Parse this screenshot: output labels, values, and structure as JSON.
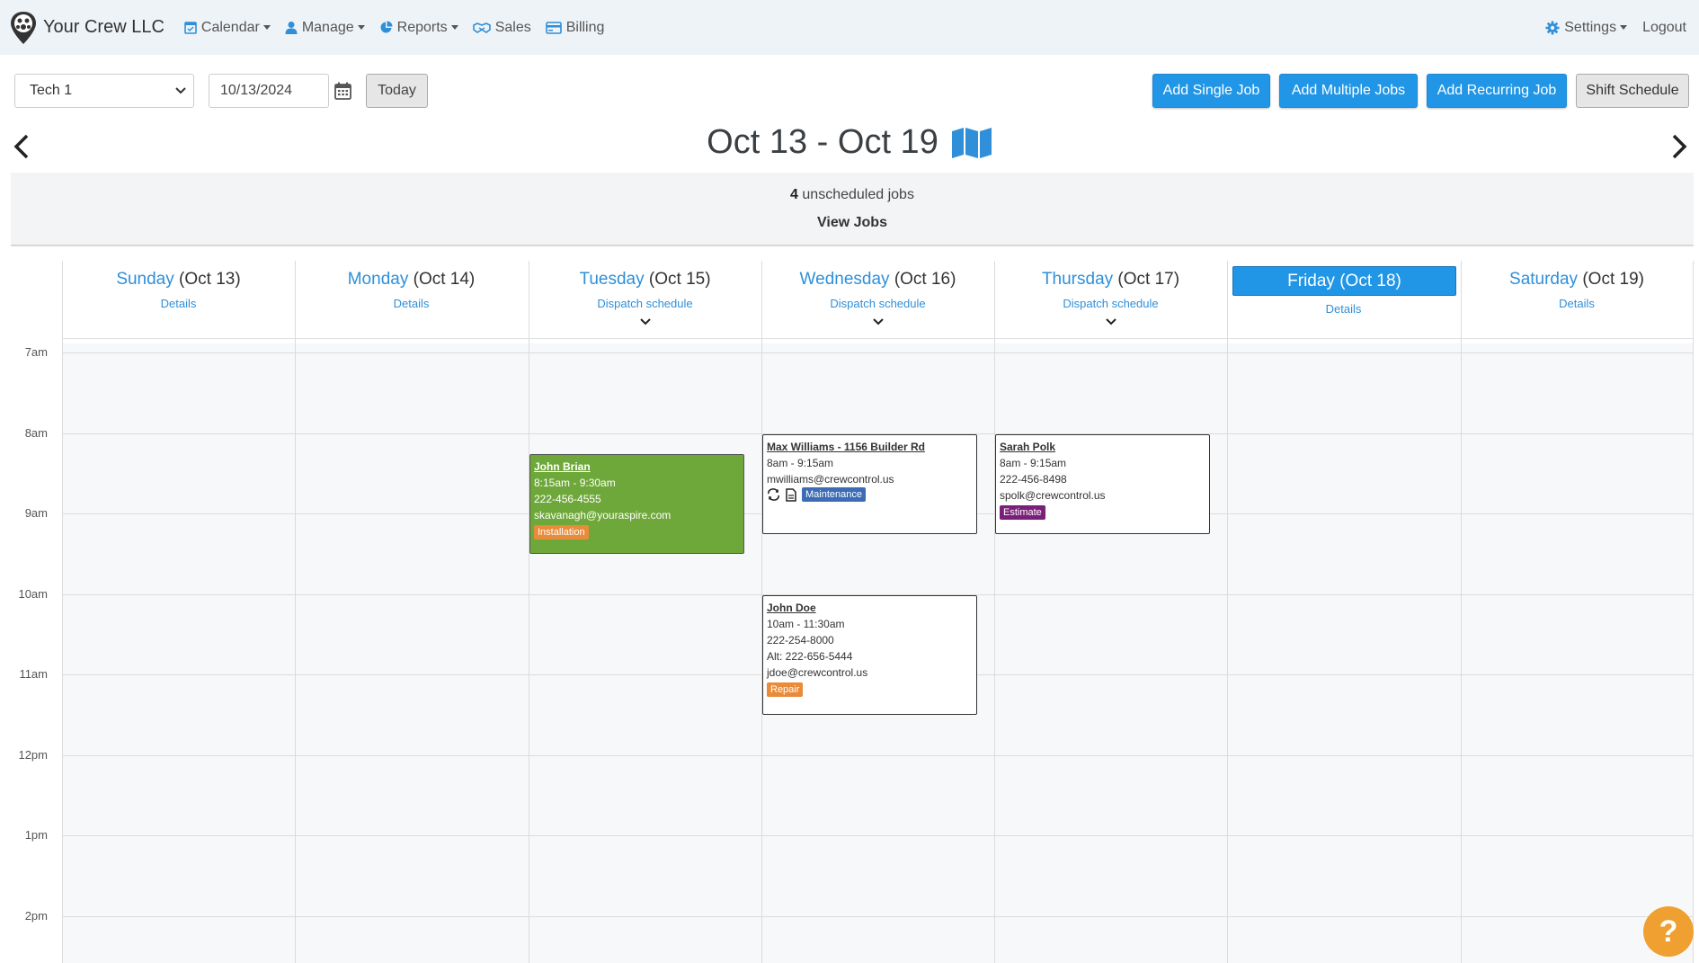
{
  "navbar": {
    "brand": "Your Crew LLC",
    "items": [
      {
        "label": "Calendar",
        "icon": "calendar-icon",
        "dropdown": true
      },
      {
        "label": "Manage",
        "icon": "user-icon",
        "dropdown": true
      },
      {
        "label": "Reports",
        "icon": "pie-chart-icon",
        "dropdown": true
      },
      {
        "label": "Sales",
        "icon": "handshake-icon",
        "dropdown": false
      },
      {
        "label": "Billing",
        "icon": "credit-card-icon",
        "dropdown": false
      }
    ],
    "settings": "Settings",
    "logout": "Logout"
  },
  "toolbar": {
    "tech_select": "Tech 1",
    "date_value": "10/13/2024",
    "today": "Today",
    "add_single": "Add Single Job",
    "add_multiple": "Add Multiple Jobs",
    "add_recurring": "Add Recurring Job",
    "shift_schedule": "Shift Schedule"
  },
  "week": {
    "title": "Oct 13 - Oct 19",
    "unscheduled_count": "4",
    "unscheduled_text": "unscheduled jobs",
    "view_jobs": "View Jobs"
  },
  "days": [
    {
      "name": "Sunday",
      "date": "(Oct 13)",
      "link": "Details",
      "chevron": false,
      "today": false
    },
    {
      "name": "Monday",
      "date": "(Oct 14)",
      "link": "Details",
      "chevron": false,
      "today": false
    },
    {
      "name": "Tuesday",
      "date": "(Oct 15)",
      "link": "Dispatch schedule",
      "chevron": true,
      "today": false
    },
    {
      "name": "Wednesday",
      "date": "(Oct 16)",
      "link": "Dispatch schedule",
      "chevron": true,
      "today": false
    },
    {
      "name": "Thursday",
      "date": "(Oct 17)",
      "link": "Dispatch schedule",
      "chevron": true,
      "today": false
    },
    {
      "name": "Friday",
      "date": "(Oct 18)",
      "link": "Details",
      "chevron": false,
      "today": true
    },
    {
      "name": "Saturday",
      "date": "(Oct 19)",
      "link": "Details",
      "chevron": false,
      "today": false
    }
  ],
  "hours": [
    "7am",
    "8am",
    "9am",
    "10am",
    "11am",
    "12pm",
    "1pm",
    "2pm"
  ],
  "jobs": {
    "john_brian": {
      "title": "John Brian",
      "time": "8:15am - 9:30am",
      "phone": "222-456-4555",
      "email": "skavanagh@youraspire.com",
      "badge": "Installation"
    },
    "max_williams": {
      "title": "Max Williams - 1156 Builder Rd",
      "time": "8am - 9:15am",
      "email": "mwilliams@crewcontrol.us",
      "badge": "Maintenance"
    },
    "sarah_polk": {
      "title": "Sarah Polk",
      "time": "8am - 9:15am",
      "phone": "222-456-8498",
      "email": "spolk@crewcontrol.us",
      "badge": "Estimate"
    },
    "john_doe": {
      "title": "John Doe",
      "time": "10am - 11:30am",
      "phone": "222-254-8000",
      "alt_phone": "Alt: 222-656-5444",
      "email": "jdoe@crewcontrol.us",
      "badge": "Repair"
    }
  },
  "colors": {
    "primary": "#2196e6",
    "job_green": "#6fa83a",
    "badge_installation": "#e88b3a",
    "badge_maintenance": "#3d6bb5",
    "badge_estimate": "#7a1f7a",
    "badge_repair": "#e88b3a",
    "help": "#f0a030"
  },
  "help": "?"
}
